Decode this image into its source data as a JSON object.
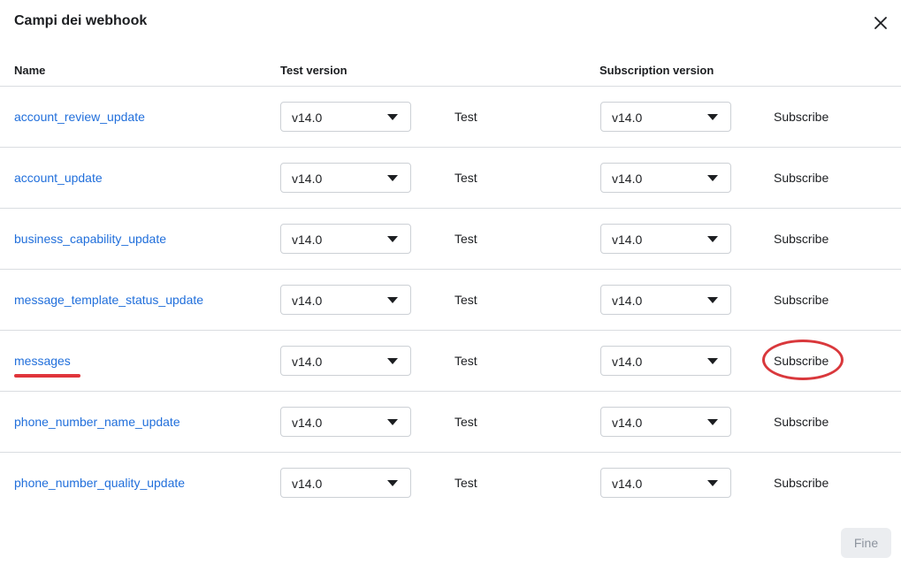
{
  "dialog": {
    "title": "Campi dei webhook",
    "close_icon": "close-icon"
  },
  "table": {
    "headers": {
      "name": "Name",
      "test_version": "Test version",
      "subscription_version": "Subscription version"
    },
    "rows": [
      {
        "field": "account_review_update",
        "test_version": "v14.0",
        "test_label": "Test",
        "subscription_version": "v14.0",
        "subscribe_label": "Subscribe"
      },
      {
        "field": "account_update",
        "test_version": "v14.0",
        "test_label": "Test",
        "subscription_version": "v14.0",
        "subscribe_label": "Subscribe"
      },
      {
        "field": "business_capability_update",
        "test_version": "v14.0",
        "test_label": "Test",
        "subscription_version": "v14.0",
        "subscribe_label": "Subscribe"
      },
      {
        "field": "message_template_status_update",
        "test_version": "v14.0",
        "test_label": "Test",
        "subscription_version": "v14.0",
        "subscribe_label": "Subscribe"
      },
      {
        "field": "messages",
        "test_version": "v14.0",
        "test_label": "Test",
        "subscription_version": "v14.0",
        "subscribe_label": "Subscribe",
        "highlighted": true
      },
      {
        "field": "phone_number_name_update",
        "test_version": "v14.0",
        "test_label": "Test",
        "subscription_version": "v14.0",
        "subscribe_label": "Subscribe"
      },
      {
        "field": "phone_number_quality_update",
        "test_version": "v14.0",
        "test_label": "Test",
        "subscription_version": "v14.0",
        "subscribe_label": "Subscribe"
      }
    ]
  },
  "footer": {
    "done_label": "Fine"
  },
  "colors": {
    "link": "#216fdb",
    "annotation": "#e0353b",
    "border": "#dadde1"
  }
}
